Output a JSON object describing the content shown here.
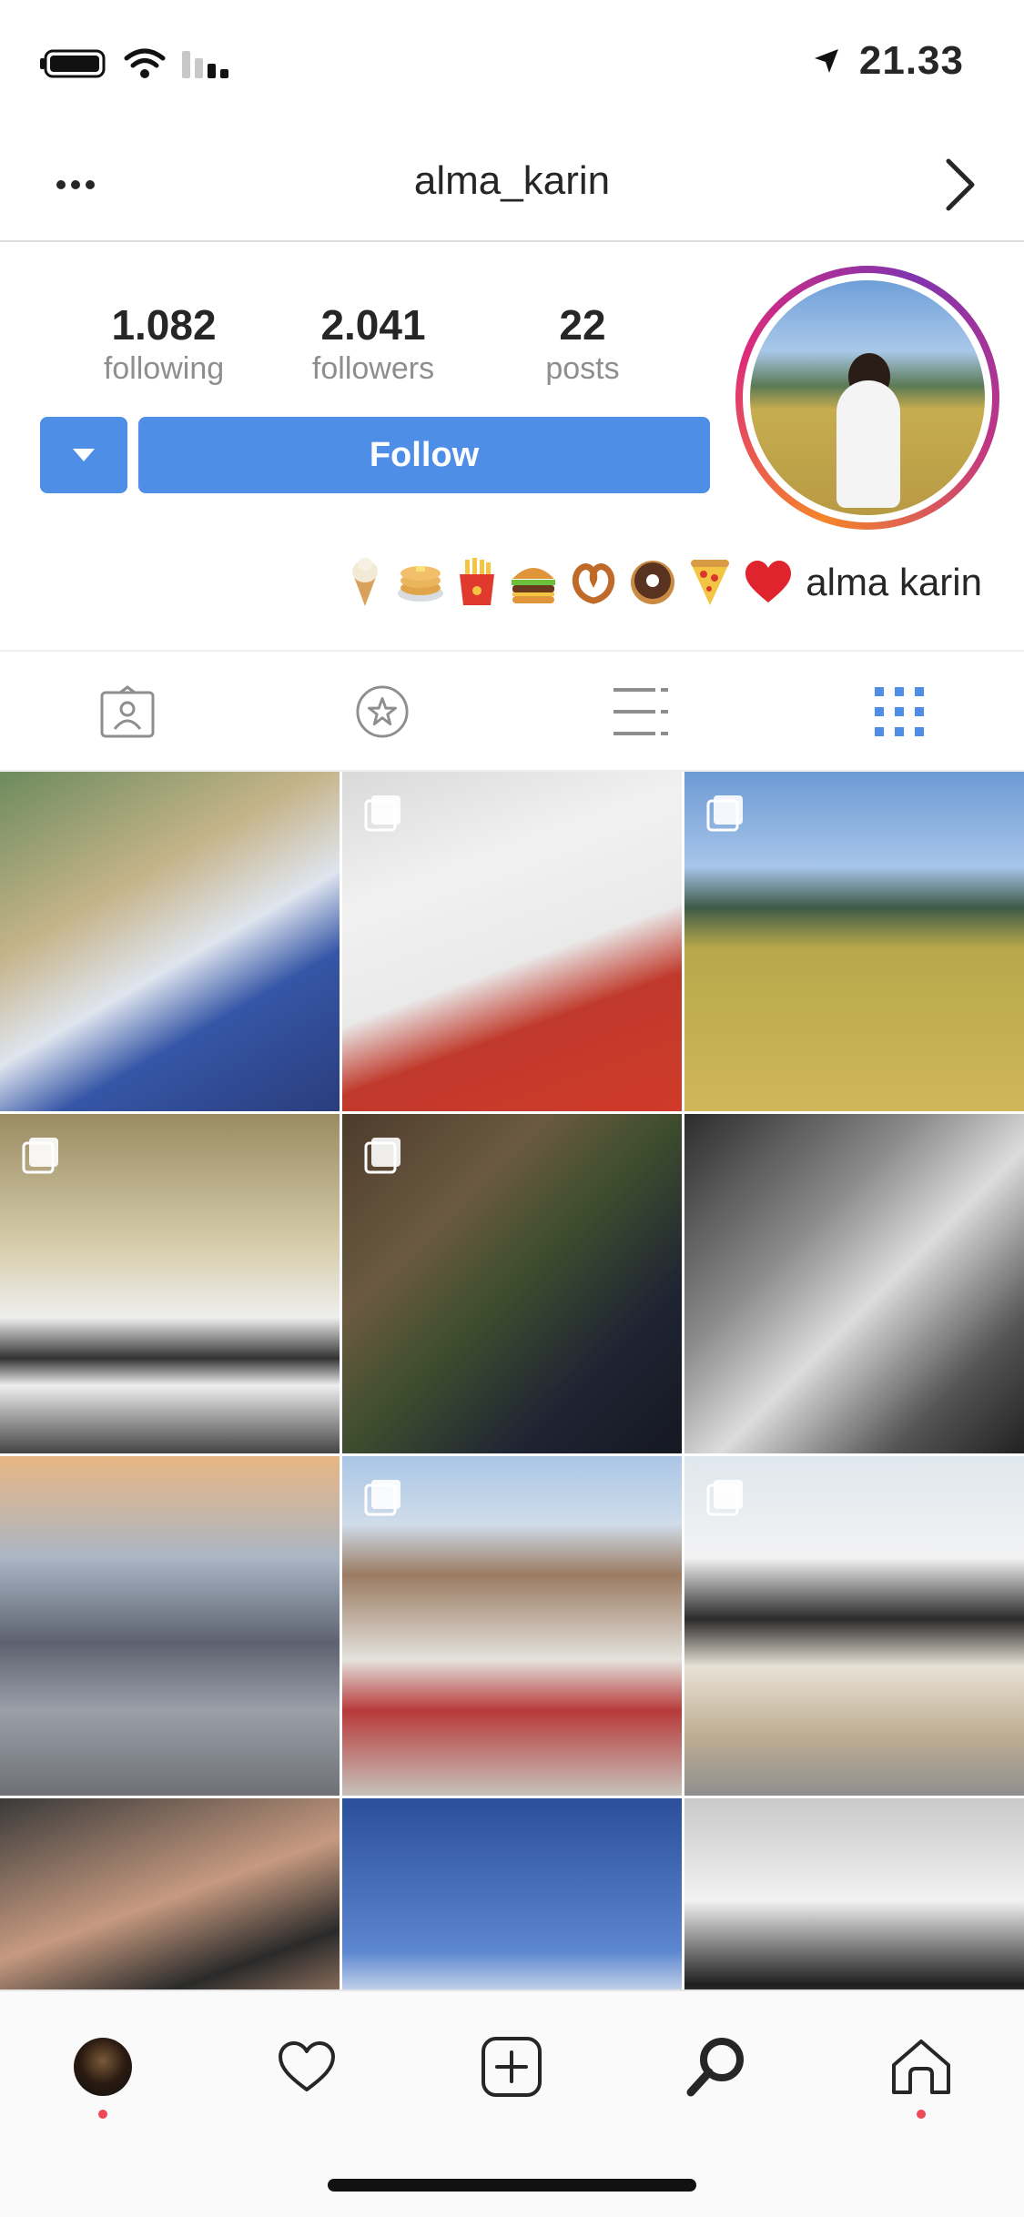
{
  "status_bar": {
    "time": "21.33"
  },
  "nav": {
    "title": "alma_karin"
  },
  "profile": {
    "stats": [
      {
        "value": "1.082",
        "label": "following"
      },
      {
        "value": "2.041",
        "label": "followers"
      },
      {
        "value": "22",
        "label": "posts"
      }
    ],
    "follow_label": "Follow",
    "bio_name": "alma karin",
    "bio_emojis": [
      "soft-ice-cream",
      "pancakes",
      "french-fries",
      "hamburger",
      "pretzel",
      "doughnut",
      "pizza",
      "red-heart"
    ]
  },
  "tabs": [
    "tagged",
    "saved",
    "list",
    "grid"
  ],
  "bottom_nav": [
    "profile",
    "activity",
    "new-post",
    "search",
    "home"
  ],
  "colors": {
    "accent": "#4f8ee6",
    "notification": "#ed4956"
  }
}
